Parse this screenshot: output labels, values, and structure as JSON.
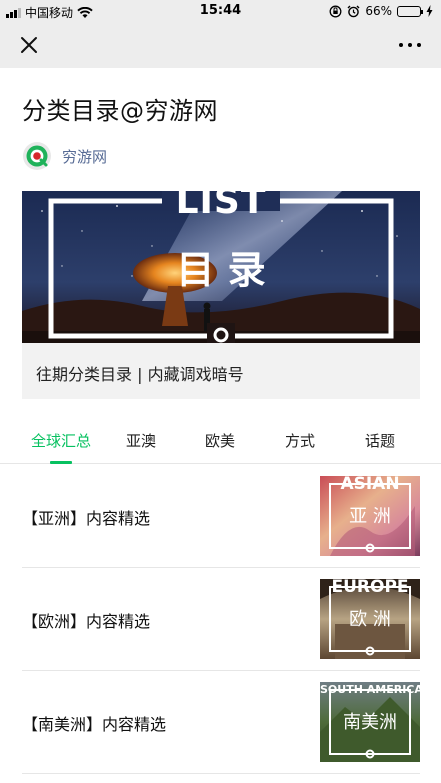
{
  "status_bar": {
    "carrier": "中国移动",
    "time": "15:44",
    "battery_percent": "66%",
    "battery_level": 0.66
  },
  "nav": {
    "close_icon": "close-icon",
    "more_icon": "more-icon"
  },
  "article": {
    "title": "分类目录@穷游网",
    "account_name": "穷游网"
  },
  "banner": {
    "overlay_top": "LIST",
    "overlay_main": "目 录",
    "caption": "往期分类目录 | 内藏调戏暗号"
  },
  "tabs": [
    {
      "label": "全球汇总",
      "active": true
    },
    {
      "label": "亚澳",
      "active": false
    },
    {
      "label": "欧美",
      "active": false
    },
    {
      "label": "方式",
      "active": false
    },
    {
      "label": "话题",
      "active": false
    }
  ],
  "items": [
    {
      "title": "【亚洲】内容精选",
      "thumb_en": "ASIAN",
      "thumb_cn": "亚 洲"
    },
    {
      "title": "【欧洲】内容精选",
      "thumb_en": "EUROPE",
      "thumb_cn": "欧 洲"
    },
    {
      "title": "【南美洲】内容精选",
      "thumb_en": "SOUTH AMERICA",
      "thumb_cn": "南美洲"
    }
  ],
  "colors": {
    "accent": "#07c160",
    "account_link": "#576b95"
  }
}
